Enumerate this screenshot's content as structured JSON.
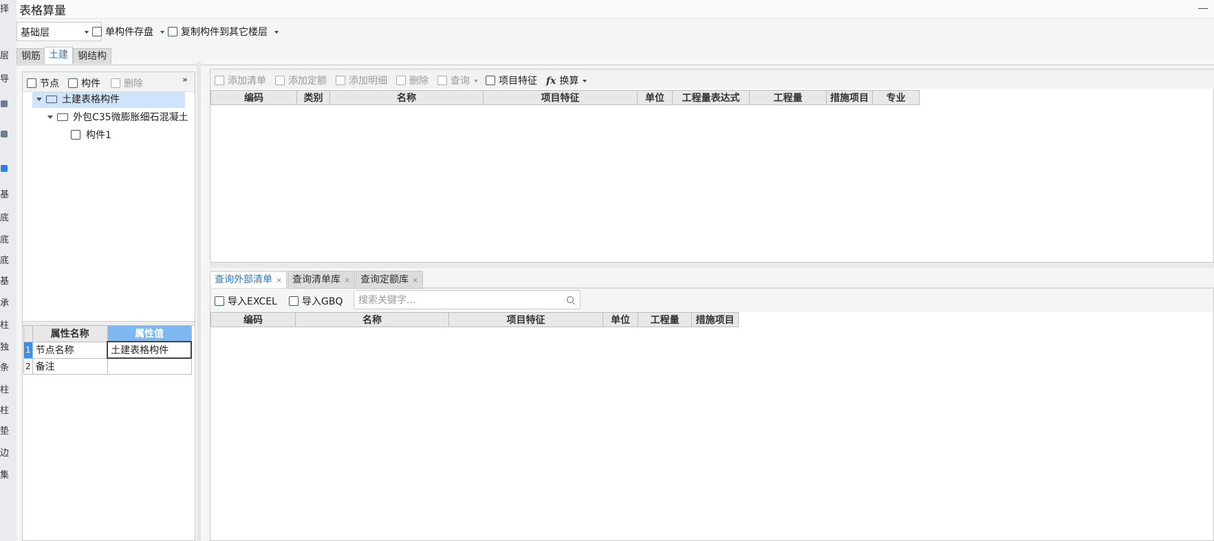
{
  "window": {
    "title": "表格算量",
    "minimize": "—"
  },
  "bg_strip": {
    "chars": [
      "择",
      "层",
      "导",
      "基",
      "底",
      "底",
      "底",
      "基",
      "承",
      "柱",
      "独",
      "条",
      "柱",
      "柱",
      "垫",
      "边",
      "集"
    ]
  },
  "toolbar": {
    "floor": "基础层",
    "save_label": "单构件存盘",
    "copy_label": "复制构件到其它楼层"
  },
  "tabs": [
    {
      "label": "钢筋"
    },
    {
      "label": "土建"
    },
    {
      "label": "钢结构"
    }
  ],
  "left_tools": {
    "node": "节点",
    "component": "构件",
    "delete": "删除",
    "more": "»"
  },
  "tree": [
    {
      "label": "土建表格构件",
      "level": 0
    },
    {
      "label": "外包C35微膨胀细石混凝土",
      "level": 1
    },
    {
      "label": "构件1",
      "level": 2
    }
  ],
  "props": {
    "headers": [
      "属性名称",
      "属性值"
    ],
    "rows": [
      {
        "num": "1",
        "name": "节点名称",
        "value": "土建表格构件"
      },
      {
        "num": "2",
        "name": "备注",
        "value": ""
      }
    ]
  },
  "right_tools": {
    "add_list": "添加清单",
    "add_quota": "添加定额",
    "add_detail": "添加明细",
    "delete": "删除",
    "query": "查询",
    "feature": "项目特征",
    "calc": "换算",
    "calc_icon": "fx"
  },
  "top_grid": {
    "columns": [
      "编码",
      "类别",
      "名称",
      "项目特征",
      "单位",
      "工程量表达式",
      "工程量",
      "措施项目",
      "专业"
    ]
  },
  "bottom_tabs": [
    {
      "label": "查询外部清单"
    },
    {
      "label": "查询清单库"
    },
    {
      "label": "查询定额库"
    }
  ],
  "import": {
    "excel": "导入EXCEL",
    "gbq": "导入GBQ",
    "search_placeholder": "搜索关键字..."
  },
  "bottom_grid": {
    "columns": [
      "编码",
      "名称",
      "项目特征",
      "单位",
      "工程量",
      "措施项目"
    ]
  }
}
